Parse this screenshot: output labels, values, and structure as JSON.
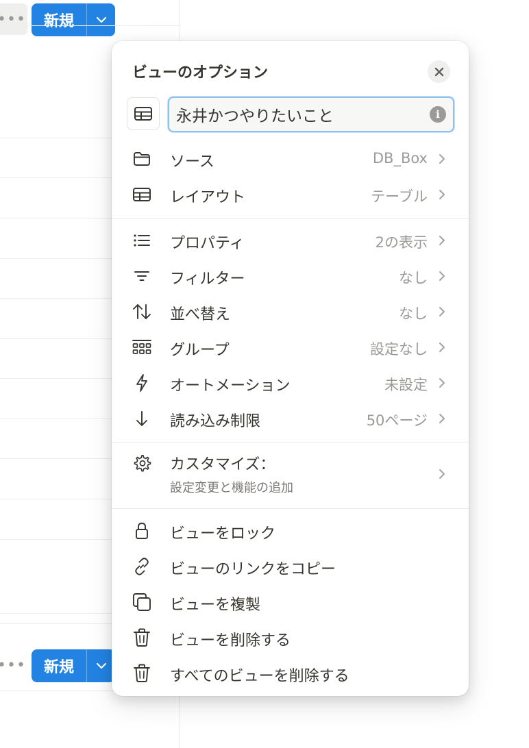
{
  "toolbar": {
    "more_label": "•••",
    "new_label": "新規"
  },
  "popup": {
    "title": "ビューのオプション",
    "view_name": "永井かつやりたいこと",
    "info_label": "i",
    "settings": [
      {
        "label": "ソース",
        "value": "DB_Box",
        "icon": "folder-icon"
      },
      {
        "label": "レイアウト",
        "value": "テーブル",
        "icon": "table-icon"
      }
    ],
    "controls": [
      {
        "label": "プロパティ",
        "value": "2の表示",
        "icon": "list-icon"
      },
      {
        "label": "フィルター",
        "value": "なし",
        "icon": "filter-icon"
      },
      {
        "label": "並べ替え",
        "value": "なし",
        "icon": "sort-icon"
      },
      {
        "label": "グループ",
        "value": "設定なし",
        "icon": "group-icon"
      },
      {
        "label": "オートメーション",
        "value": "未設定",
        "icon": "lightning-icon"
      },
      {
        "label": "読み込み制限",
        "value": "50ページ",
        "icon": "arrow-down-icon"
      }
    ],
    "customize": {
      "label": "カスタマイズ：",
      "sub": "設定変更と機能の追加",
      "icon": "gear-icon"
    },
    "actions": [
      {
        "label": "ビューをロック",
        "icon": "lock-icon"
      },
      {
        "label": "ビューのリンクをコピー",
        "icon": "link-icon"
      },
      {
        "label": "ビューを複製",
        "icon": "duplicate-icon"
      },
      {
        "label": "ビューを削除する",
        "icon": "trash-icon"
      },
      {
        "label": "すべてのビューを削除する",
        "icon": "trash-icon"
      }
    ]
  },
  "colors": {
    "accent": "#2383e2",
    "text": "#37352f",
    "muted": "#9b9a97"
  }
}
